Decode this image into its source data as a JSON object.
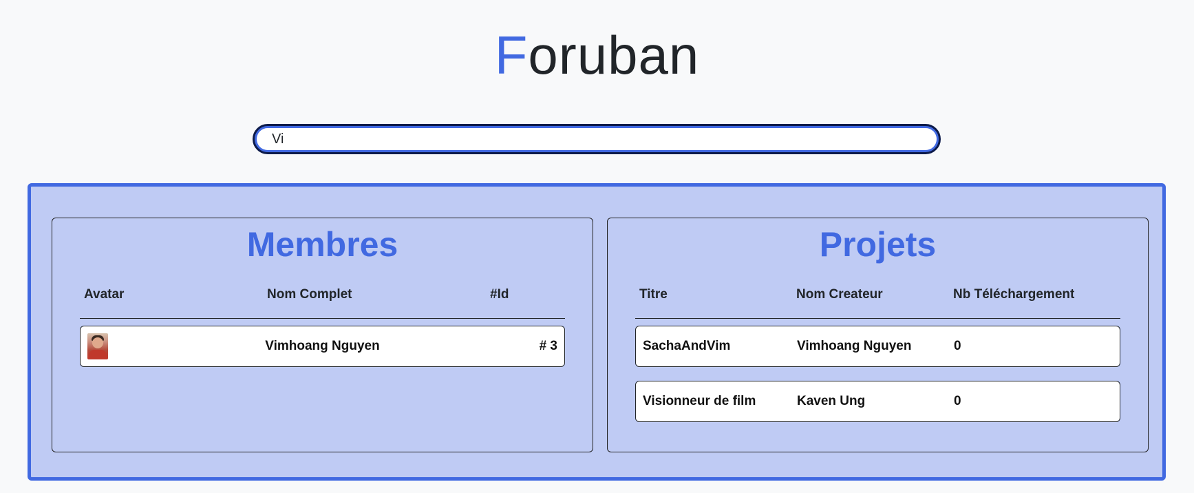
{
  "header": {
    "logo_accent": "F",
    "logo_rest": "oruban"
  },
  "search": {
    "value": "Vi",
    "placeholder": ""
  },
  "members": {
    "title": "Membres",
    "columns": [
      "Avatar",
      "Nom Complet",
      "#Id"
    ],
    "rows": [
      {
        "avatar": "member-photo",
        "name": "Vimhoang Nguyen",
        "id": "# 3"
      }
    ]
  },
  "projects": {
    "title": "Projets",
    "columns": [
      "Titre",
      "Nom Createur",
      "Nb Téléchargement"
    ],
    "rows": [
      {
        "title": "SachaAndVim",
        "creator": "Vimhoang Nguyen",
        "downloads": "0"
      },
      {
        "title": "Visionneur de film",
        "creator": "Kaven Ung",
        "downloads": "0"
      }
    ]
  },
  "colors": {
    "accent": "#4169e1",
    "results_bg": "#bfcbf4",
    "search_border_outer": "#0d1b4a"
  }
}
